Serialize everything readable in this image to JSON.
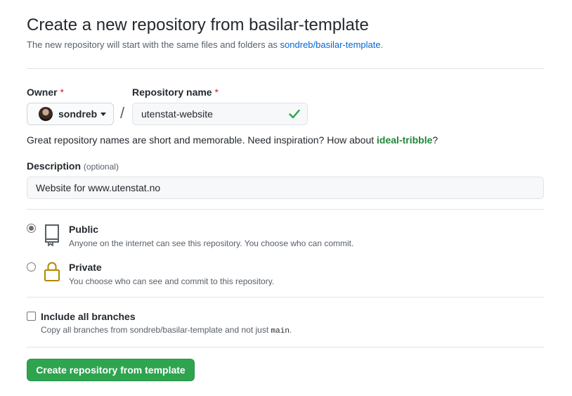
{
  "header": {
    "title": "Create a new repository from basilar-template",
    "subtitle_prefix": "The new repository will start with the same files and folders as ",
    "subtitle_link": "sondreb/basilar-template",
    "subtitle_suffix": "."
  },
  "owner": {
    "label": "Owner",
    "required_mark": "*",
    "value": "sondreb"
  },
  "repo_name": {
    "label": "Repository name",
    "required_mark": "*",
    "value": "utenstat-website",
    "separator": "/"
  },
  "name_hint": {
    "text": "Great repository names are short and memorable. Need inspiration? How about ",
    "suggestion": "ideal-tribble",
    "suffix": "?"
  },
  "description": {
    "label": "Description",
    "optional": "(optional)",
    "value": "Website for www.utenstat.no"
  },
  "visibility": {
    "public": {
      "title": "Public",
      "desc": "Anyone on the internet can see this repository. You choose who can commit.",
      "selected": true
    },
    "private": {
      "title": "Private",
      "desc": "You choose who can see and commit to this repository.",
      "selected": false
    }
  },
  "branches": {
    "title": "Include all branches",
    "desc_prefix": "Copy all branches from sondreb/basilar-template and not just ",
    "desc_code": "main",
    "desc_suffix": ".",
    "checked": false
  },
  "submit": {
    "label": "Create repository from template"
  },
  "colors": {
    "accent_green": "#2ea44f",
    "link_blue": "#0366d6",
    "required_red": "#cb2431",
    "lock_gold": "#b08800"
  },
  "icons": {
    "owner_caret": "chevron-down-icon",
    "name_valid": "check-icon",
    "public": "repo-icon",
    "private": "lock-icon"
  }
}
